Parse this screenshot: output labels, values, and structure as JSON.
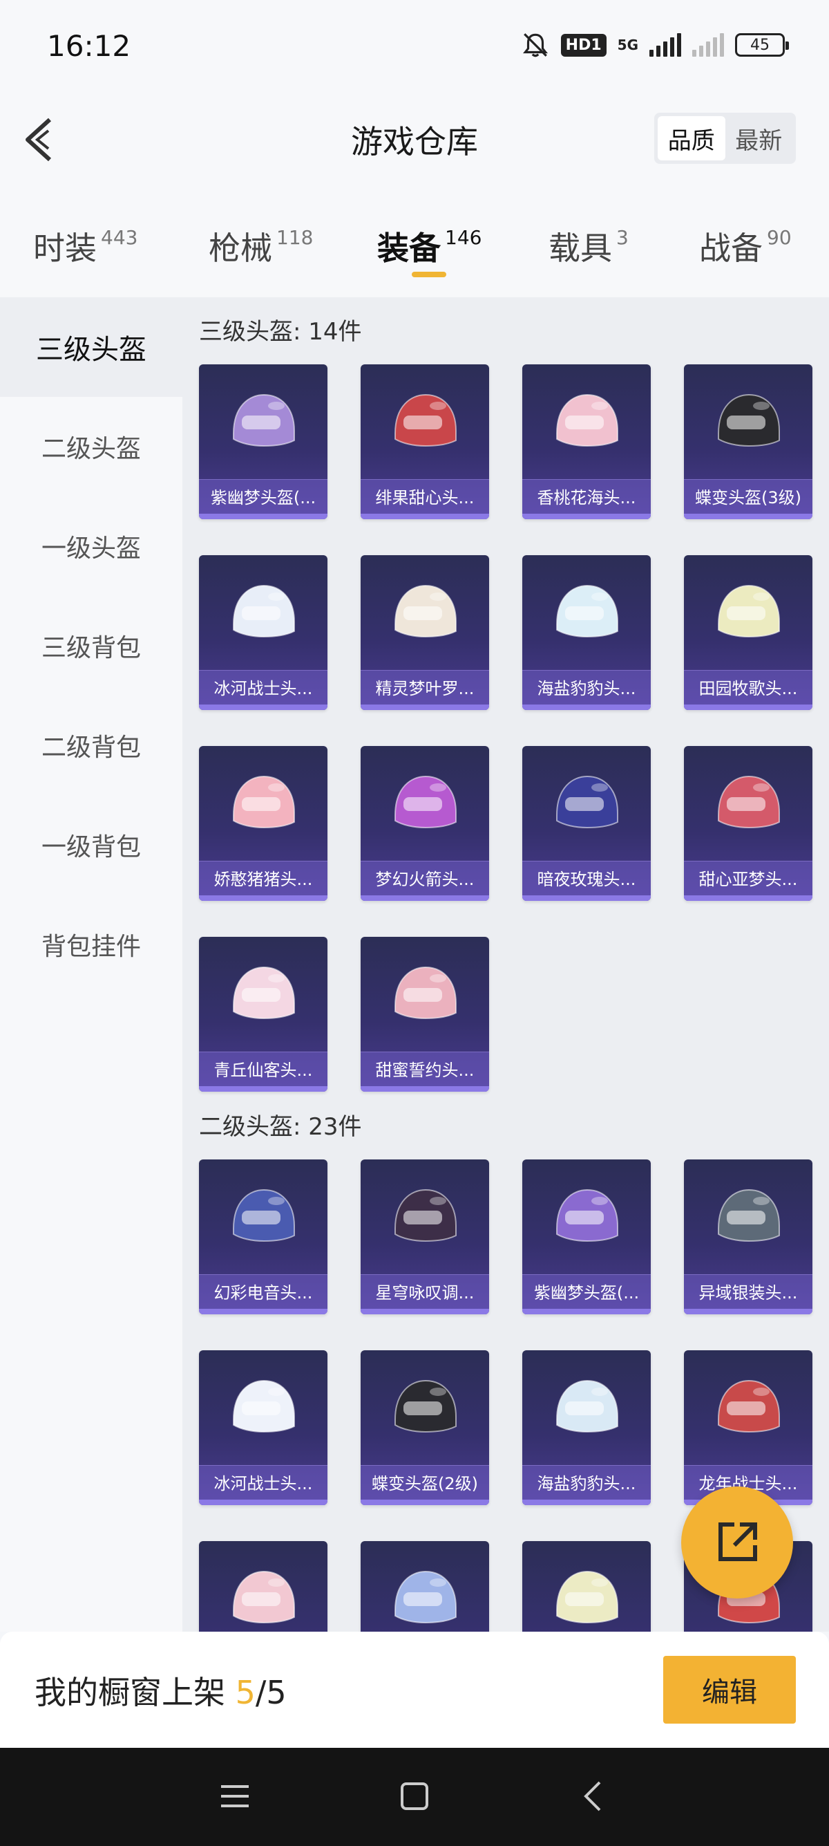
{
  "status_bar": {
    "time": "16:12",
    "hd": "HD1",
    "network": "5G",
    "battery": "45"
  },
  "header": {
    "title": "游戏仓库",
    "sort_options": [
      "品质",
      "最新"
    ]
  },
  "tabs": [
    {
      "label": "时装",
      "count": "443"
    },
    {
      "label": "枪械",
      "count": "118"
    },
    {
      "label": "装备",
      "count": "146"
    },
    {
      "label": "载具",
      "count": "3"
    },
    {
      "label": "战备",
      "count": "90"
    }
  ],
  "sidebar": [
    "三级头盔",
    "二级头盔",
    "一级头盔",
    "三级背包",
    "二级背包",
    "一级背包",
    "背包挂件"
  ],
  "sections": [
    {
      "title": "三级头盔: 14件",
      "items": [
        {
          "name": "紫幽梦头盔(...",
          "color": "#a48ad6"
        },
        {
          "name": "绯果甜心头...",
          "color": "#c9464a"
        },
        {
          "name": "香桃花海头...",
          "color": "#f1c1cf"
        },
        {
          "name": "蝶变头盔(3级)",
          "color": "#2a2a2e"
        },
        {
          "name": "冰河战士头...",
          "color": "#e8eef8"
        },
        {
          "name": "精灵梦叶罗...",
          "color": "#efe6da"
        },
        {
          "name": "海盐豹豹头...",
          "color": "#dceef7"
        },
        {
          "name": "田园牧歌头...",
          "color": "#ecebc0"
        },
        {
          "name": "娇憨猪猪头...",
          "color": "#f3b3bf"
        },
        {
          "name": "梦幻火箭头...",
          "color": "#b65ad0"
        },
        {
          "name": "暗夜玫瑰头...",
          "color": "#3a3f9a"
        },
        {
          "name": "甜心亚梦头...",
          "color": "#d45a6a"
        },
        {
          "name": "青丘仙客头...",
          "color": "#f4d7e3"
        },
        {
          "name": "甜蜜誓约头...",
          "color": "#ebb1be"
        }
      ]
    },
    {
      "title": "二级头盔: 23件",
      "items": [
        {
          "name": "幻彩电音头...",
          "color": "#4a5bb0"
        },
        {
          "name": "星穹咏叹调...",
          "color": "#3d2e48"
        },
        {
          "name": "紫幽梦头盔(...",
          "color": "#8a6ad0"
        },
        {
          "name": "异域银装头...",
          "color": "#5d6a78"
        },
        {
          "name": "冰河战士头...",
          "color": "#eef2fa"
        },
        {
          "name": "蝶变头盔(2级)",
          "color": "#2a2a30"
        },
        {
          "name": "海盐豹豹头...",
          "color": "#d9e9f5"
        },
        {
          "name": "龙年战士头...",
          "color": "#c84a4a"
        },
        {
          "name": "",
          "color": "#f2c8d2"
        },
        {
          "name": "",
          "color": "#9fb4e8"
        },
        {
          "name": "",
          "color": "#ecebc4"
        },
        {
          "name": "",
          "color": "#d04848"
        }
      ]
    }
  ],
  "bottom_bar": {
    "shelf_label": "我的橱窗上架 ",
    "shelf_current": "5",
    "shelf_total": "/5",
    "edit_button": "编辑"
  },
  "colors": {
    "accent": "#f3b233",
    "card_bottom": "#8b79e6"
  }
}
